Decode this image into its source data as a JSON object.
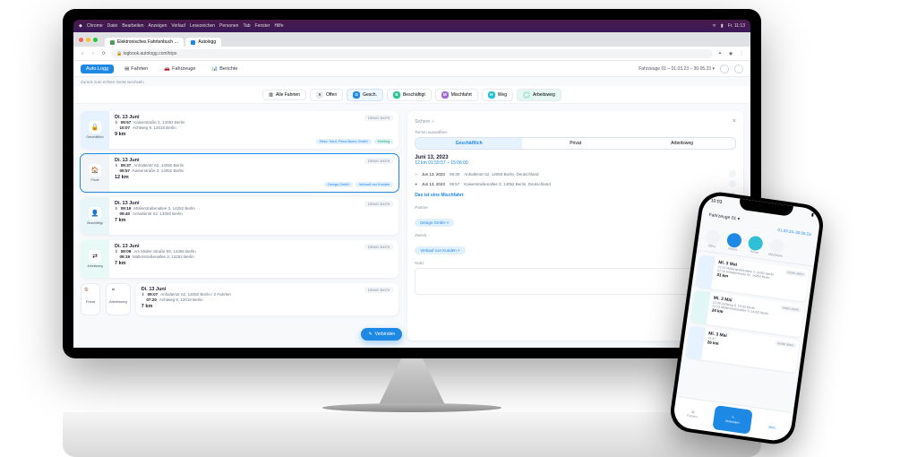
{
  "macMenu": {
    "app": "Chrome",
    "items": [
      "Datei",
      "Bearbeiten",
      "Anzeigen",
      "Verlauf",
      "Lesezeichen",
      "Personen",
      "Tab",
      "Fenster",
      "Hilfe"
    ],
    "clock": "Fr. 11:13"
  },
  "chrome": {
    "tab1": "Elektronisches Fahrtenbuch …",
    "tab2": "Autologg",
    "url": "logbook.autologg.com/trips"
  },
  "app": {
    "nav": {
      "logg": "Auto.Logg",
      "fahrten": "Fahrten",
      "fahrzeuge": "Fahrzeuge",
      "berichte": "Berichte"
    },
    "vehicle": "Fahrzeuge 01 – 01.03.23 – 30.05.23 ▾",
    "sub": "Zurück zum echten Gerät wechseln",
    "filters": {
      "alle": "Alle Fahrten",
      "offen": "Offen",
      "gesch": "Gesch.",
      "besch": "Beschäftigt",
      "misch": "Mischfahrt",
      "weg": "Weg",
      "arbeit": "Arbeitsweg"
    }
  },
  "trips": [
    {
      "date": "Di. 13 Juni",
      "t1": "09:57",
      "a1": "Kaiserstraße 3, 14052 Berlin",
      "t2": "10:07",
      "a2": "Achtweg 8, 12018 Berlin",
      "km": "9 km",
      "badge": "DEMO 30070",
      "tag1": "Besc. Kauf, Firma Buero GmbH",
      "tag2": "Meeting"
    },
    {
      "date": "Di. 13 Juni",
      "t1": "09:37",
      "a1": "Anhalterstr 62, 14050 Berlin",
      "t2": "09:57",
      "a2": "Kaiserstraße 3, 14052 Berlin",
      "km": "12 km",
      "badge": "DEMO 30070",
      "tag1": "Design GmbH",
      "tag2": "Verkauf von Kunden"
    },
    {
      "date": "Di. 13 Juni",
      "t1": "09:19",
      "a1": "Müllerstraßenallee 3, 14252 Berlin",
      "t2": "09:40",
      "a2": "Anhalterstr 62, 14050 Berlin",
      "km": "7 km",
      "badge": "DEMO 30070"
    },
    {
      "date": "Di. 13 Juni",
      "t1": "09:09",
      "a1": "Am Müller-Straße 59, 14366 Berlin",
      "t2": "09:19",
      "a2": "Müllerstraßenallee 3, 14252 Berlin",
      "km": "7 km",
      "badge": "DEMO 30070"
    }
  ],
  "trip5": {
    "date": "Di. 13 Juni",
    "t1": "09:07",
    "a1": "Anhalterstr 62, 14050 Berlin / 2 Fahrten",
    "t2": "07:20",
    "a2": "Achtweg 8, 12018 Berlin",
    "km": "7 km",
    "badge": "DEMO 30070"
  },
  "fab": "Verbinden",
  "miniPriv": "Privat",
  "miniArb": "Arbeitsweg",
  "detail": {
    "save": "Sichern ✓",
    "termLbl": "Termin auswählen",
    "seg": {
      "g": "Geschäftlich",
      "p": "Privat",
      "a": "Arbeitsweg"
    },
    "date": "Juni 13, 2023",
    "sub": "12 km 01:59:57 – 15:06:00",
    "wp1": {
      "d": "Jun 13, 2023",
      "t": "09:30",
      "a": "Anhalterstr 62, 14050 Berlin, Deutschland"
    },
    "wp2": {
      "d": "Jun 13, 2023",
      "t": "09:57",
      "a": "Kaiserstraßenallee 3, 14052 Berlin, Deutschland"
    },
    "merge": "Das ist eine Mischfahrt",
    "partner": "Partner",
    "partnerVal": "Design GmbH ×",
    "zweck": "Zweck",
    "zweckVal": "Verkauf von Kunden ×",
    "notiz": "Notiz"
  },
  "phone": {
    "time": "10:03",
    "vehicle": "Fahrzeuge 01 ▾",
    "range": "01.03.23–30.05.23",
    "cats": [
      "Offen",
      "Gesch.",
      "Privat",
      "Mischfahrt",
      "Arbeitsweg"
    ],
    "trips": [
      {
        "d": "Mi. 3 Mai",
        "t1": "22:21",
        "a1": "Müllerstraßenallee 3, 14252 Berlin",
        "t2": "22:29",
        "a2": "Anhalterstraße 62, 14050 Berlin",
        "km": "31 km",
        "b": "DEMO 30070"
      },
      {
        "d": "Mi. 3 Mai",
        "t1": "22:06",
        "a1": "Achtweg 8, 12018 Berlin",
        "t2": "22:21",
        "a2": "Müllerstraßenallee 3, 14252 Berlin",
        "km": "24 km",
        "b": "DEMO 30070"
      },
      {
        "d": "Mi. 3 Mai",
        "t1": "21:47",
        "km": "26 km",
        "b": "DEMO 30070"
      }
    ],
    "nav": {
      "f": "Fahrten",
      "v": "Verbinden",
      "m": "Mehr"
    }
  }
}
